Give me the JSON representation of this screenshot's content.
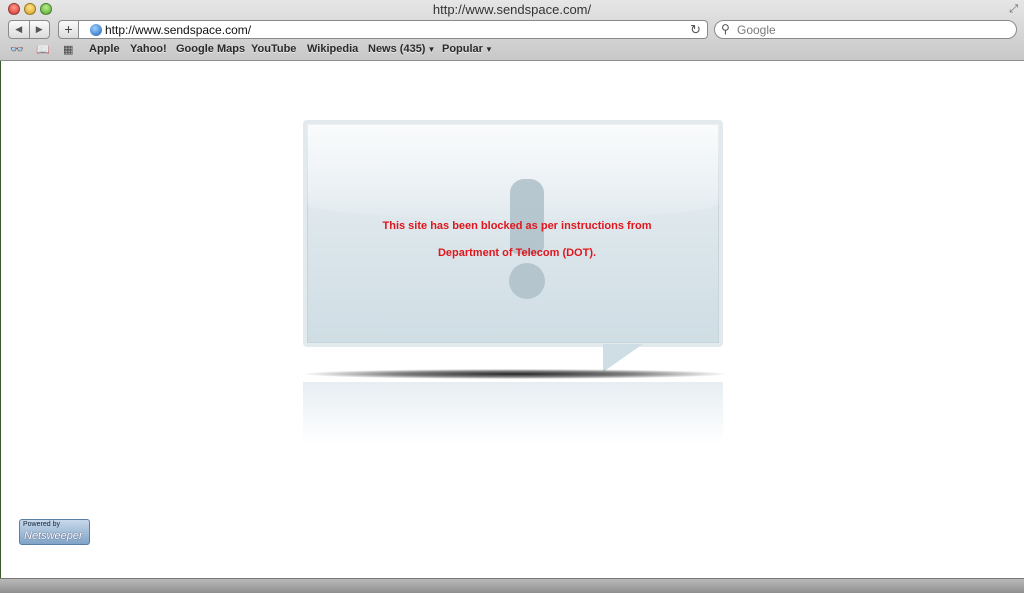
{
  "window": {
    "title": "http://www.sendspace.com/"
  },
  "toolbar": {
    "url": "http://www.sendspace.com/",
    "search_placeholder": "Google"
  },
  "bookmarks": [
    {
      "label": "Apple"
    },
    {
      "label": "Yahoo!"
    },
    {
      "label": "Google Maps"
    },
    {
      "label": "YouTube"
    },
    {
      "label": "Wikipedia"
    },
    {
      "label": "News (435)"
    },
    {
      "label": "Popular"
    }
  ],
  "content": {
    "message_line1": "This site has been blocked as per instructions from",
    "message_line2": "Department of Telecom (DOT).",
    "accent_color": "#e0161c"
  },
  "badge": {
    "powered_by": "Powered by",
    "brand": "Netsweeper"
  }
}
